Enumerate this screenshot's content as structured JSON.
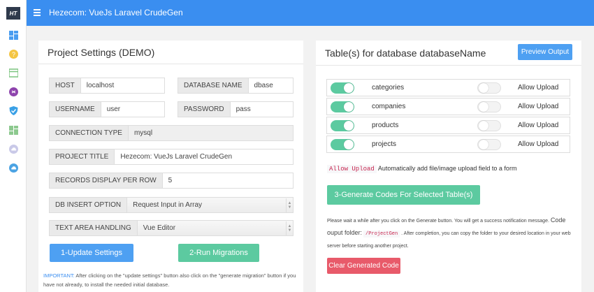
{
  "app": {
    "title": "Hezecom: VueJs Laravel CrudeGen",
    "logo_text": "HT"
  },
  "sidebar": {
    "icons": [
      {
        "name": "dashboard-icon",
        "color": "#4a9df0"
      },
      {
        "name": "help-icon",
        "color": "#f4c542"
      },
      {
        "name": "table-icon",
        "color": "#7bc47f"
      },
      {
        "name": "settings-icon",
        "color": "#8e44ad"
      },
      {
        "name": "shield-icon",
        "color": "#3aa0e6"
      },
      {
        "name": "grid-icon",
        "color": "#8dc98f"
      },
      {
        "name": "cloud-icon",
        "color": "#c9c9e8"
      },
      {
        "name": "cloud-upload-icon",
        "color": "#4ba3e3"
      }
    ]
  },
  "left_panel": {
    "title": "Project Settings (DEMO)",
    "host": {
      "label": "HOST",
      "value": "localhost"
    },
    "database_name": {
      "label": "DATABASE NAME",
      "value": "dbase"
    },
    "username": {
      "label": "USERNAME",
      "value": "user"
    },
    "password": {
      "label": "PASSWORD",
      "value": "pass"
    },
    "connection_type": {
      "label": "CONNECTION TYPE",
      "value": "mysql"
    },
    "project_title": {
      "label": "PROJECT TITLE",
      "value": "Hezecom: VueJs Laravel CrudeGen"
    },
    "records_per_row": {
      "label": "RECORDS DISPLAY PER ROW",
      "value": "5"
    },
    "db_insert_option": {
      "label": "DB INSERT OPTION",
      "value": "Request Input in Array"
    },
    "text_area_handling": {
      "label": "TEXT AREA HANDLING",
      "value": "Vue Editor"
    },
    "update_button": "1-Update Settings",
    "migrations_button": "2-Run Migrations",
    "note_important": "IMPORTANT:",
    "note_text": " After clicking on the \"update settings\" button also click on the \"generate migration\" button if you have not already, to install the needed initial database."
  },
  "right_panel": {
    "title": "Table(s) for database databaseName",
    "preview_button": "Preview Output",
    "tables": [
      {
        "name": "categories",
        "upload_label": "Allow Upload",
        "selected": true,
        "upload": false
      },
      {
        "name": "companies",
        "upload_label": "Allow Upload",
        "selected": true,
        "upload": false
      },
      {
        "name": "products",
        "upload_label": "Allow Upload",
        "selected": true,
        "upload": false
      },
      {
        "name": "projects",
        "upload_label": "Allow Upload",
        "selected": true,
        "upload": false
      }
    ],
    "upload_code": "Allow Upload",
    "upload_help": "Automatically add file/image upload field to a form",
    "generate_button": "3-Generate Codes For Selected Table(s)",
    "wait_text_1": "Please wait a while after you click on the Generate button. You will get a success notification message.",
    "wait_text_big": "Code ouput folder:",
    "wait_code": "/ProjectGen",
    "wait_text_2": ". After completion, you can copy the folder to your desired location in your web server before starting another project.",
    "clear_button": "Clear Generated Code"
  }
}
